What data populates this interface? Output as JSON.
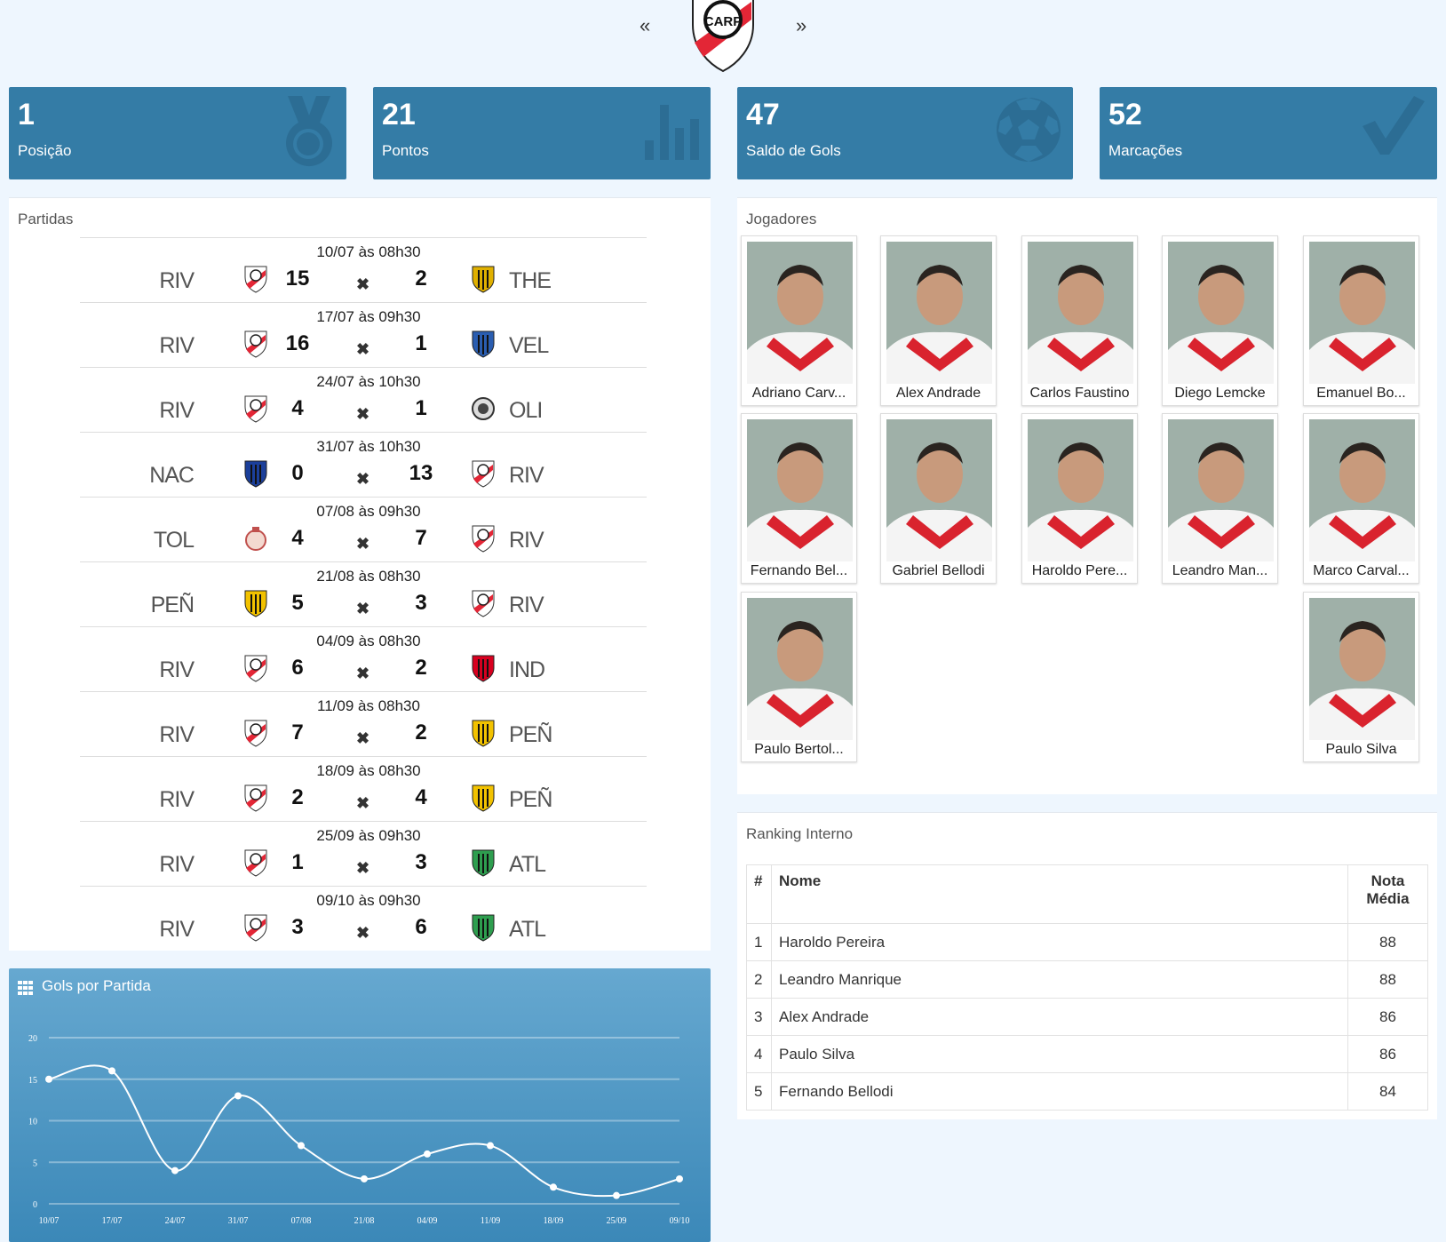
{
  "nav": {
    "prev": "«",
    "next": "»",
    "logo": "CARP"
  },
  "stats": [
    {
      "value": "1",
      "label": "Posição",
      "icon": "medal-icon"
    },
    {
      "value": "21",
      "label": "Pontos",
      "icon": "bar-chart-icon"
    },
    {
      "value": "47",
      "label": "Saldo de Gols",
      "icon": "soccer-ball-icon"
    },
    {
      "value": "52",
      "label": "Marcações",
      "icon": "checkmark-icon"
    }
  ],
  "matches_panel": {
    "title": "Partidas",
    "separator": "✖"
  },
  "matches": [
    {
      "date": "10/07 às 08h30",
      "home": "RIV",
      "home_score": "15",
      "away_score": "2",
      "away": "THE"
    },
    {
      "date": "17/07 às 09h30",
      "home": "RIV",
      "home_score": "16",
      "away_score": "1",
      "away": "VEL"
    },
    {
      "date": "24/07 às 10h30",
      "home": "RIV",
      "home_score": "4",
      "away_score": "1",
      "away": "OLI"
    },
    {
      "date": "31/07 às 10h30",
      "home": "NAC",
      "home_score": "0",
      "away_score": "13",
      "away": "RIV"
    },
    {
      "date": "07/08 às 09h30",
      "home": "TOL",
      "home_score": "4",
      "away_score": "7",
      "away": "RIV"
    },
    {
      "date": "21/08 às 08h30",
      "home": "PEÑ",
      "home_score": "5",
      "away_score": "3",
      "away": "RIV"
    },
    {
      "date": "04/09 às 08h30",
      "home": "RIV",
      "home_score": "6",
      "away_score": "2",
      "away": "IND"
    },
    {
      "date": "11/09 às 08h30",
      "home": "RIV",
      "home_score": "7",
      "away_score": "2",
      "away": "PEÑ"
    },
    {
      "date": "18/09 às 08h30",
      "home": "RIV",
      "home_score": "2",
      "away_score": "4",
      "away": "PEÑ"
    },
    {
      "date": "25/09 às 09h30",
      "home": "RIV",
      "home_score": "1",
      "away_score": "3",
      "away": "ATL"
    },
    {
      "date": "09/10 às 09h30",
      "home": "RIV",
      "home_score": "3",
      "away_score": "6",
      "away": "ATL"
    }
  ],
  "team_colors": {
    "RIV": "#e32636",
    "THE": "#e0b000",
    "VEL": "#2a5db0",
    "OLI": "#444444",
    "NAC": "#1b3f9a",
    "TOL": "#c0504d",
    "PEÑ": "#f2c200",
    "IND": "#d8001f",
    "ATL": "#2e9e4f"
  },
  "players_panel": {
    "title": "Jogadores"
  },
  "players": [
    "Adriano Carv...",
    "Alex Andrade",
    "Carlos Faustino",
    "Diego Lemcke",
    "Emanuel Bo...",
    "Fernando Bel...",
    "Gabriel Bellodi",
    "Haroldo Pere...",
    "Leandro Man...",
    "Marco Carval...",
    "Paulo Bertol...",
    "Paulo Silva"
  ],
  "ranking": {
    "title": "Ranking Interno",
    "headers": {
      "pos": "#",
      "name": "Nome",
      "score_line1": "Nota",
      "score_line2": "Média"
    },
    "rows": [
      {
        "pos": "1",
        "name": "Haroldo Pereira",
        "score": "88"
      },
      {
        "pos": "2",
        "name": "Leandro Manrique",
        "score": "88"
      },
      {
        "pos": "3",
        "name": "Alex Andrade",
        "score": "86"
      },
      {
        "pos": "4",
        "name": "Paulo Silva",
        "score": "86"
      },
      {
        "pos": "5",
        "name": "Fernando Bellodi",
        "score": "84"
      }
    ]
  },
  "chart_data": {
    "type": "line",
    "title": "Gols por Partida",
    "categories": [
      "10/07",
      "17/07",
      "24/07",
      "31/07",
      "07/08",
      "21/08",
      "04/09",
      "11/09",
      "18/09",
      "25/09",
      "09/10"
    ],
    "values": [
      15,
      16,
      4,
      13,
      7,
      3,
      6,
      7,
      2,
      1,
      3
    ],
    "yticks": [
      "0",
      "5",
      "10",
      "15",
      "20"
    ],
    "ylim": [
      0,
      20
    ],
    "grid": true
  }
}
